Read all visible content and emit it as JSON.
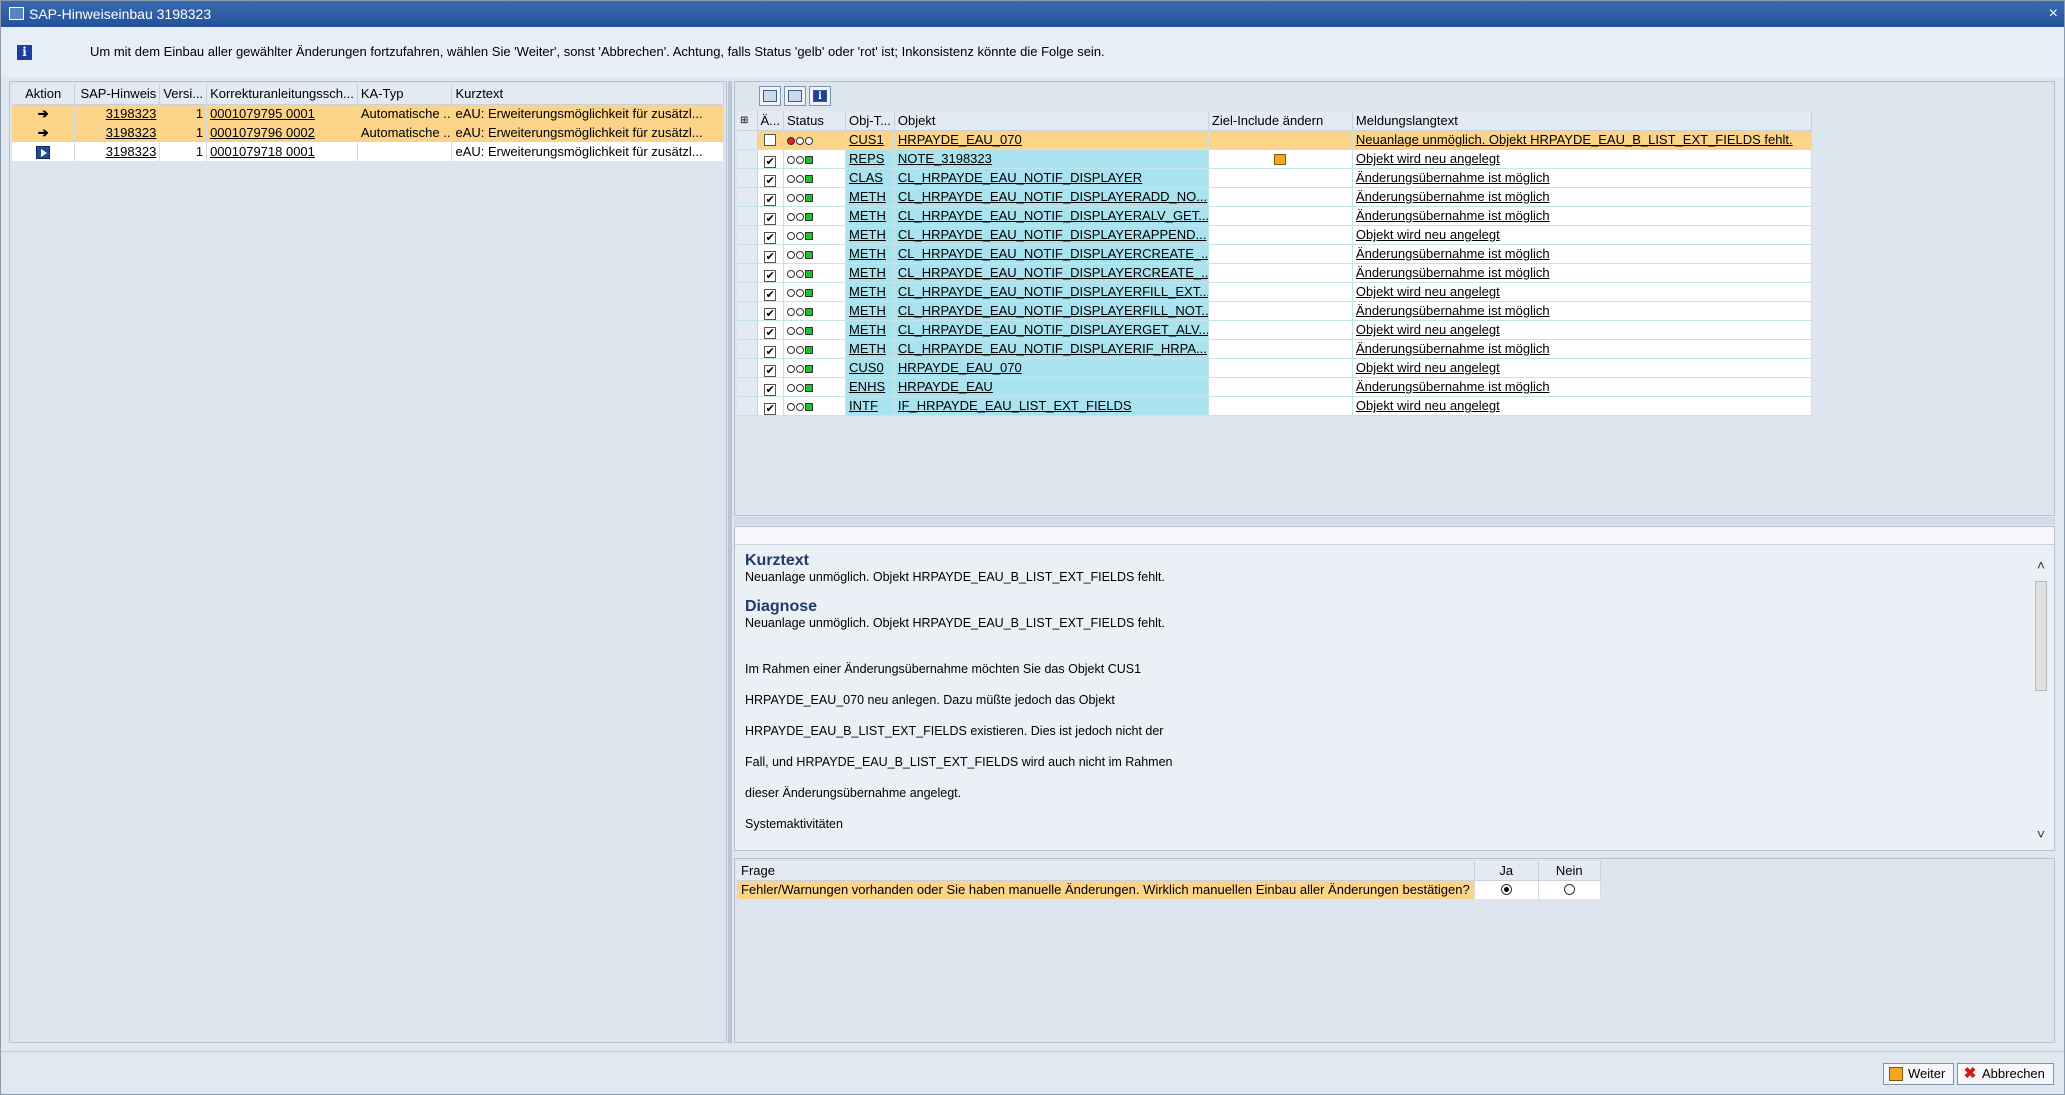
{
  "window": {
    "title": "SAP-Hinweiseinbau 3198323",
    "close": "×"
  },
  "info": {
    "message": "Um mit dem Einbau aller gewählter Änderungen fortzufahren, wählen Sie 'Weiter', sonst 'Abbrechen'. Achtung, falls Status 'gelb' oder 'rot' ist; Inkonsistenz könnte die Folge sein."
  },
  "left_table": {
    "headers": [
      "Aktion",
      "SAP-Hinweis",
      "Versi...",
      "Korrekturanleitungssch...",
      "KA-Typ",
      "Kurztext"
    ],
    "rows": [
      {
        "hinweis": "3198323",
        "version": "1",
        "korr": "0001079795 0001",
        "katyp": "Automatische ...",
        "kurztext": "eAU: Erweiterungsmöglichkeit für zusätzl..."
      },
      {
        "hinweis": "3198323",
        "version": "1",
        "korr": "0001079796 0002",
        "katyp": "Automatische ...",
        "kurztext": "eAU: Erweiterungsmöglichkeit für zusätzl..."
      },
      {
        "hinweis": "3198323",
        "version": "1",
        "korr": "0001079718 0001",
        "katyp": "",
        "kurztext": "eAU: Erweiterungsmöglichkeit für zusätzl..."
      }
    ]
  },
  "right_table": {
    "headers": [
      "Ä...",
      "Status",
      "Obj-T...",
      "Objekt",
      "Ziel-Include ändern",
      "Meldungslangtext"
    ],
    "rows": [
      {
        "checked": false,
        "status": "red",
        "typ": "CUS1",
        "objekt": "HRPAYDE_EAU_070",
        "msg": "Neuanlage unmöglich. Objekt   HRPAYDE_EAU_B_LIST_EXT_FIELDS fehlt."
      },
      {
        "checked": true,
        "status": "green",
        "typ": "REPS",
        "objekt": "NOTE_3198323",
        "msg": "Objekt wird neu angelegt"
      },
      {
        "checked": true,
        "status": "green",
        "typ": "CLAS",
        "objekt": "CL_HRPAYDE_EAU_NOTIF_DISPLAYER",
        "msg": "Änderungsübernahme ist möglich"
      },
      {
        "checked": true,
        "status": "green",
        "typ": "METH",
        "objekt": "CL_HRPAYDE_EAU_NOTIF_DISPLAYERADD_NO...",
        "msg": "Änderungsübernahme ist möglich"
      },
      {
        "checked": true,
        "status": "green",
        "typ": "METH",
        "objekt": "CL_HRPAYDE_EAU_NOTIF_DISPLAYERALV_GET...",
        "msg": "Änderungsübernahme ist möglich"
      },
      {
        "checked": true,
        "status": "green",
        "typ": "METH",
        "objekt": "CL_HRPAYDE_EAU_NOTIF_DISPLAYERAPPEND...",
        "msg": "Objekt wird neu angelegt"
      },
      {
        "checked": true,
        "status": "green",
        "typ": "METH",
        "objekt": "CL_HRPAYDE_EAU_NOTIF_DISPLAYERCREATE_...",
        "msg": "Änderungsübernahme ist möglich"
      },
      {
        "checked": true,
        "status": "green",
        "typ": "METH",
        "objekt": "CL_HRPAYDE_EAU_NOTIF_DISPLAYERCREATE_...",
        "msg": "Änderungsübernahme ist möglich"
      },
      {
        "checked": true,
        "status": "green",
        "typ": "METH",
        "objekt": "CL_HRPAYDE_EAU_NOTIF_DISPLAYERFILL_EXT...",
        "msg": "Objekt wird neu angelegt"
      },
      {
        "checked": true,
        "status": "green",
        "typ": "METH",
        "objekt": "CL_HRPAYDE_EAU_NOTIF_DISPLAYERFILL_NOT...",
        "msg": "Änderungsübernahme ist möglich"
      },
      {
        "checked": true,
        "status": "green",
        "typ": "METH",
        "objekt": "CL_HRPAYDE_EAU_NOTIF_DISPLAYERGET_ALV...",
        "msg": "Objekt wird neu angelegt"
      },
      {
        "checked": true,
        "status": "green",
        "typ": "METH",
        "objekt": "CL_HRPAYDE_EAU_NOTIF_DISPLAYERIF_HRPA...",
        "msg": "Änderungsübernahme ist möglich"
      },
      {
        "checked": true,
        "status": "green",
        "typ": "CUS0",
        "objekt": "HRPAYDE_EAU_070",
        "msg": "Objekt wird neu angelegt"
      },
      {
        "checked": true,
        "status": "green",
        "typ": "ENHS",
        "objekt": "HRPAYDE_EAU",
        "msg": "Änderungsübernahme ist möglich"
      },
      {
        "checked": true,
        "status": "green",
        "typ": "INTF",
        "objekt": "IF_HRPAYDE_EAU_LIST_EXT_FIELDS",
        "msg": "Objekt wird neu angelegt"
      }
    ]
  },
  "detail": {
    "h1": "Kurztext",
    "p1": "Neuanlage unmöglich. Objekt HRPAYDE_EAU_B_LIST_EXT_FIELDS fehlt.",
    "h2": "Diagnose",
    "p2": "Neuanlage unmöglich. Objekt HRPAYDE_EAU_B_LIST_EXT_FIELDS fehlt.",
    "lines": [
      "Im Rahmen einer Änderungsübernahme möchten Sie das Objekt CUS1",
      "HRPAYDE_EAU_070 neu anlegen. Dazu müßte jedoch das Objekt",
      "HRPAYDE_EAU_B_LIST_EXT_FIELDS existieren. Dies ist jedoch nicht der",
      "Fall, und HRPAYDE_EAU_B_LIST_EXT_FIELDS wird auch nicht im Rahmen",
      "dieser Änderungsübernahme angelegt.",
      "Systemaktivitäten"
    ]
  },
  "question": {
    "headers": [
      "Frage",
      "Ja",
      "Nein"
    ],
    "text": "Fehler/Warnungen vorhanden oder Sie haben manuelle Änderungen. Wirklich manuellen Einbau aller Änderungen bestätigen?",
    "selected": "Ja"
  },
  "footer": {
    "weiter": "Weiter",
    "abbrechen": "Abbrechen"
  }
}
